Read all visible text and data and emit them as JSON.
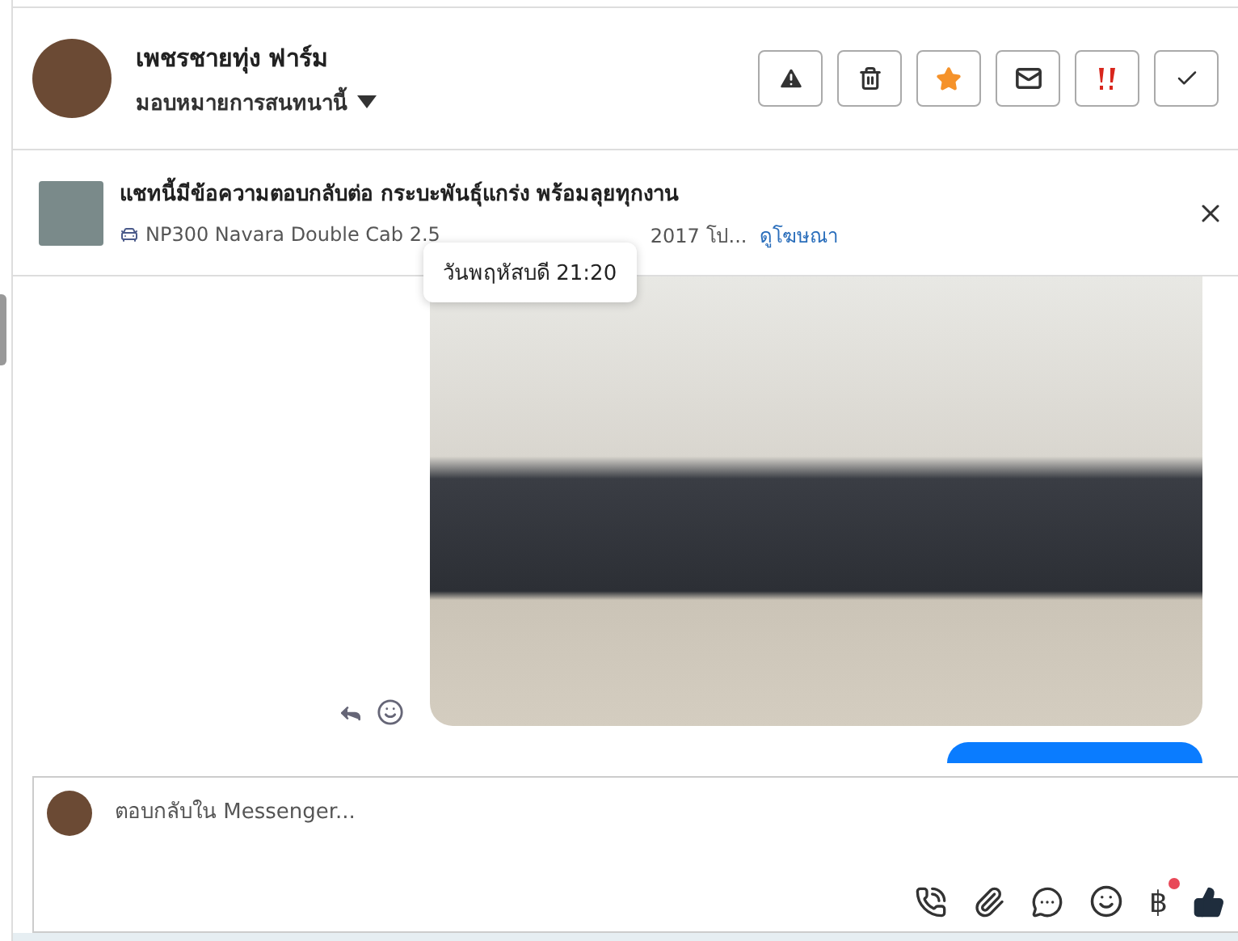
{
  "header": {
    "name": "เพชรชายทุ่ง ฟาร์ม",
    "assign": "มอบหมายการสนทนานี้",
    "actions": [
      {
        "kind": "report"
      },
      {
        "kind": "delete"
      },
      {
        "kind": "star"
      },
      {
        "kind": "mail"
      },
      {
        "kind": "urgent"
      },
      {
        "kind": "done"
      }
    ]
  },
  "ad": {
    "title": "แชทนี้มีข้อความตอบกลับต่อ กระบะพันธุ์แกร่ง พร้อมลุยทุกงาน",
    "subtitle_start": "NP300 Navara Double Cab 2.5",
    "subtitle_end": "2017 โป...",
    "link": "ดูโฆษณา"
  },
  "tooltip": "วันพฤหัสบดี 21:20",
  "composer": {
    "placeholder": "ตอบกลับใน Messenger...",
    "currency": "฿",
    "currency_badge": true
  }
}
